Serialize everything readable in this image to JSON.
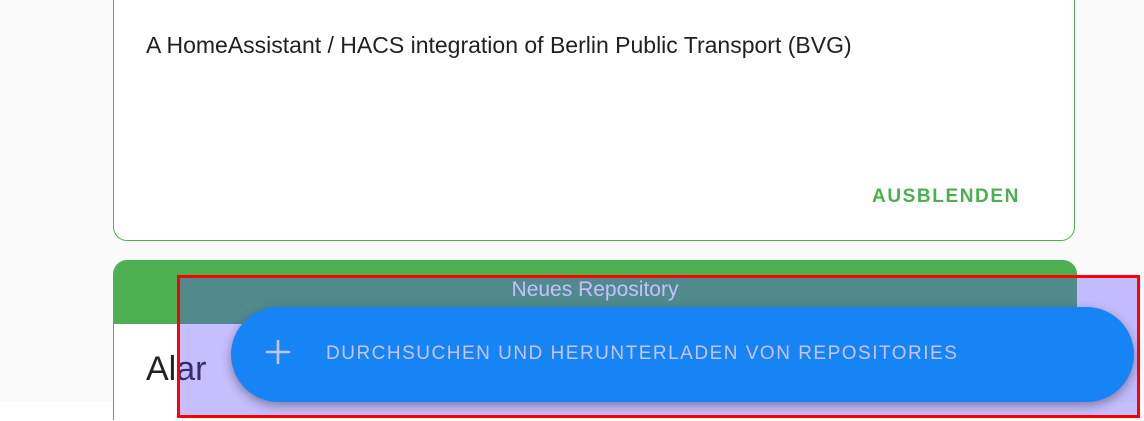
{
  "repo_card": {
    "description": "A HomeAssistant / HACS integration of Berlin Public Transport (BVG)",
    "hide_label": "AUSBLENDEN"
  },
  "new_repo_card": {
    "title": "Neues Repository",
    "name_partial": "Alar"
  },
  "fab": {
    "icon": "plus-icon",
    "label": "DURCHSUCHEN UND HERUNTERLADEN VON REPOSITORIES"
  },
  "colors": {
    "accent_green": "#4caf50",
    "fab_blue": "#1784f5",
    "highlight_red": "#ff0000"
  }
}
